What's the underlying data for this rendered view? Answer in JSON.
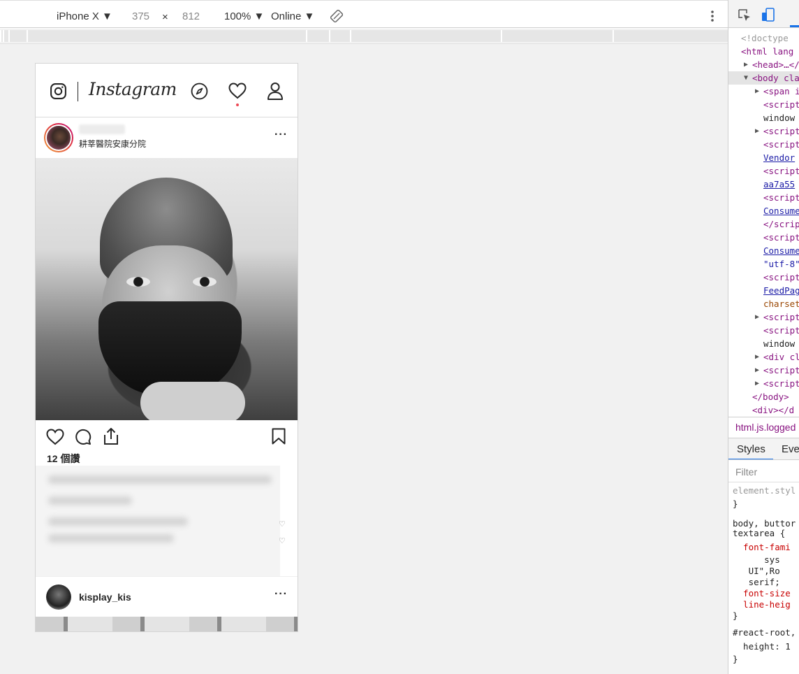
{
  "device_toolbar": {
    "device": "iPhone X ▼",
    "width": "375",
    "times": "×",
    "height": "812",
    "zoom": "100% ▼",
    "throttle": "Online ▼"
  },
  "instagram": {
    "wordmark": "Instagram",
    "post1": {
      "location": "耕莘醫院安康分院",
      "more": "···",
      "likes": "12 個讚"
    },
    "post2": {
      "username": "kisplay_kis",
      "more": "···"
    }
  },
  "devtools": {
    "lines": [
      {
        "text": "<!doctype",
        "cls": "cmt",
        "indent": 18,
        "prefix": ""
      },
      {
        "text": "<html lang",
        "cls": "tag",
        "indent": 18,
        "prefix": ""
      },
      {
        "text": "<head>…</",
        "cls": "tag",
        "indent": 34,
        "prefix": "▶"
      },
      {
        "text": "<body cla",
        "cls": "tag",
        "indent": 34,
        "prefix": "▼"
      },
      {
        "text": "<span i",
        "cls": "tag",
        "indent": 50,
        "prefix": "▶"
      },
      {
        "text": "<script",
        "cls": "tag",
        "indent": 50,
        "prefix": ""
      },
      {
        "text": "window",
        "cls": "css",
        "indent": 50,
        "prefix": ""
      },
      {
        "text": "<script",
        "cls": "tag",
        "indent": 50,
        "prefix": "▶"
      },
      {
        "text": "<script",
        "cls": "tag",
        "indent": 50,
        "prefix": ""
      },
      {
        "text": "Vendor",
        "cls": "lnk",
        "indent": 50,
        "prefix": ""
      },
      {
        "text": "<script",
        "cls": "tag",
        "indent": 50,
        "prefix": ""
      },
      {
        "text": "aa7a55",
        "cls": "lnk",
        "indent": 50,
        "prefix": ""
      },
      {
        "text": "<script",
        "cls": "tag",
        "indent": 50,
        "prefix": ""
      },
      {
        "text": "Consume",
        "cls": "lnk",
        "indent": 50,
        "prefix": ""
      },
      {
        "text": "</scrip",
        "cls": "tag",
        "indent": 50,
        "prefix": ""
      },
      {
        "text": "<script",
        "cls": "tag",
        "indent": 50,
        "prefix": ""
      },
      {
        "text": "Consume",
        "cls": "lnk",
        "indent": 50,
        "prefix": ""
      },
      {
        "text": "\"utf-8\"",
        "cls": "str",
        "indent": 50,
        "prefix": ""
      },
      {
        "text": "<script",
        "cls": "tag",
        "indent": 50,
        "prefix": ""
      },
      {
        "text": "FeedPag",
        "cls": "lnk",
        "indent": 50,
        "prefix": ""
      },
      {
        "text": "charset",
        "cls": "attr",
        "indent": 50,
        "prefix": ""
      },
      {
        "text": "<script",
        "cls": "tag",
        "indent": 50,
        "prefix": "▶"
      },
      {
        "text": "<script",
        "cls": "tag",
        "indent": 50,
        "prefix": ""
      },
      {
        "text": "window",
        "cls": "css",
        "indent": 50,
        "prefix": ""
      },
      {
        "text": "<div cl",
        "cls": "tag",
        "indent": 50,
        "prefix": "▶"
      },
      {
        "text": "<script",
        "cls": "tag",
        "indent": 50,
        "prefix": "▶"
      },
      {
        "text": "<script",
        "cls": "tag",
        "indent": 50,
        "prefix": "▶"
      },
      {
        "text": "</body>",
        "cls": "tag",
        "indent": 34,
        "prefix": ""
      },
      {
        "text": "<div></d",
        "cls": "tag",
        "indent": 34,
        "prefix": ""
      }
    ],
    "breadcrumb": "html.js.logged",
    "tab_styles": "Styles",
    "tab_event": "Eve",
    "filter_placeholder": "Filter",
    "css_lines": [
      {
        "text": "element.styl",
        "cls": "cmt"
      },
      {
        "text": "}",
        "cls": "css"
      },
      {
        "text": "body, buttor",
        "cls": "css"
      },
      {
        "text": "textarea {",
        "cls": "css"
      },
      {
        "text": "  font-fami",
        "cls": "prop"
      },
      {
        "text": "      sys",
        "cls": "css"
      },
      {
        "text": "   UI\",Ro",
        "cls": "css"
      },
      {
        "text": "   serif;",
        "cls": "css"
      },
      {
        "text": "  font-size",
        "cls": "prop"
      },
      {
        "text": "  line-heig",
        "cls": "prop"
      },
      {
        "text": "}",
        "cls": "css"
      },
      {
        "text": "#react-root,",
        "cls": "css"
      },
      {
        "text": "  height: 1",
        "cls": "css"
      },
      {
        "text": "}",
        "cls": "css"
      }
    ]
  }
}
